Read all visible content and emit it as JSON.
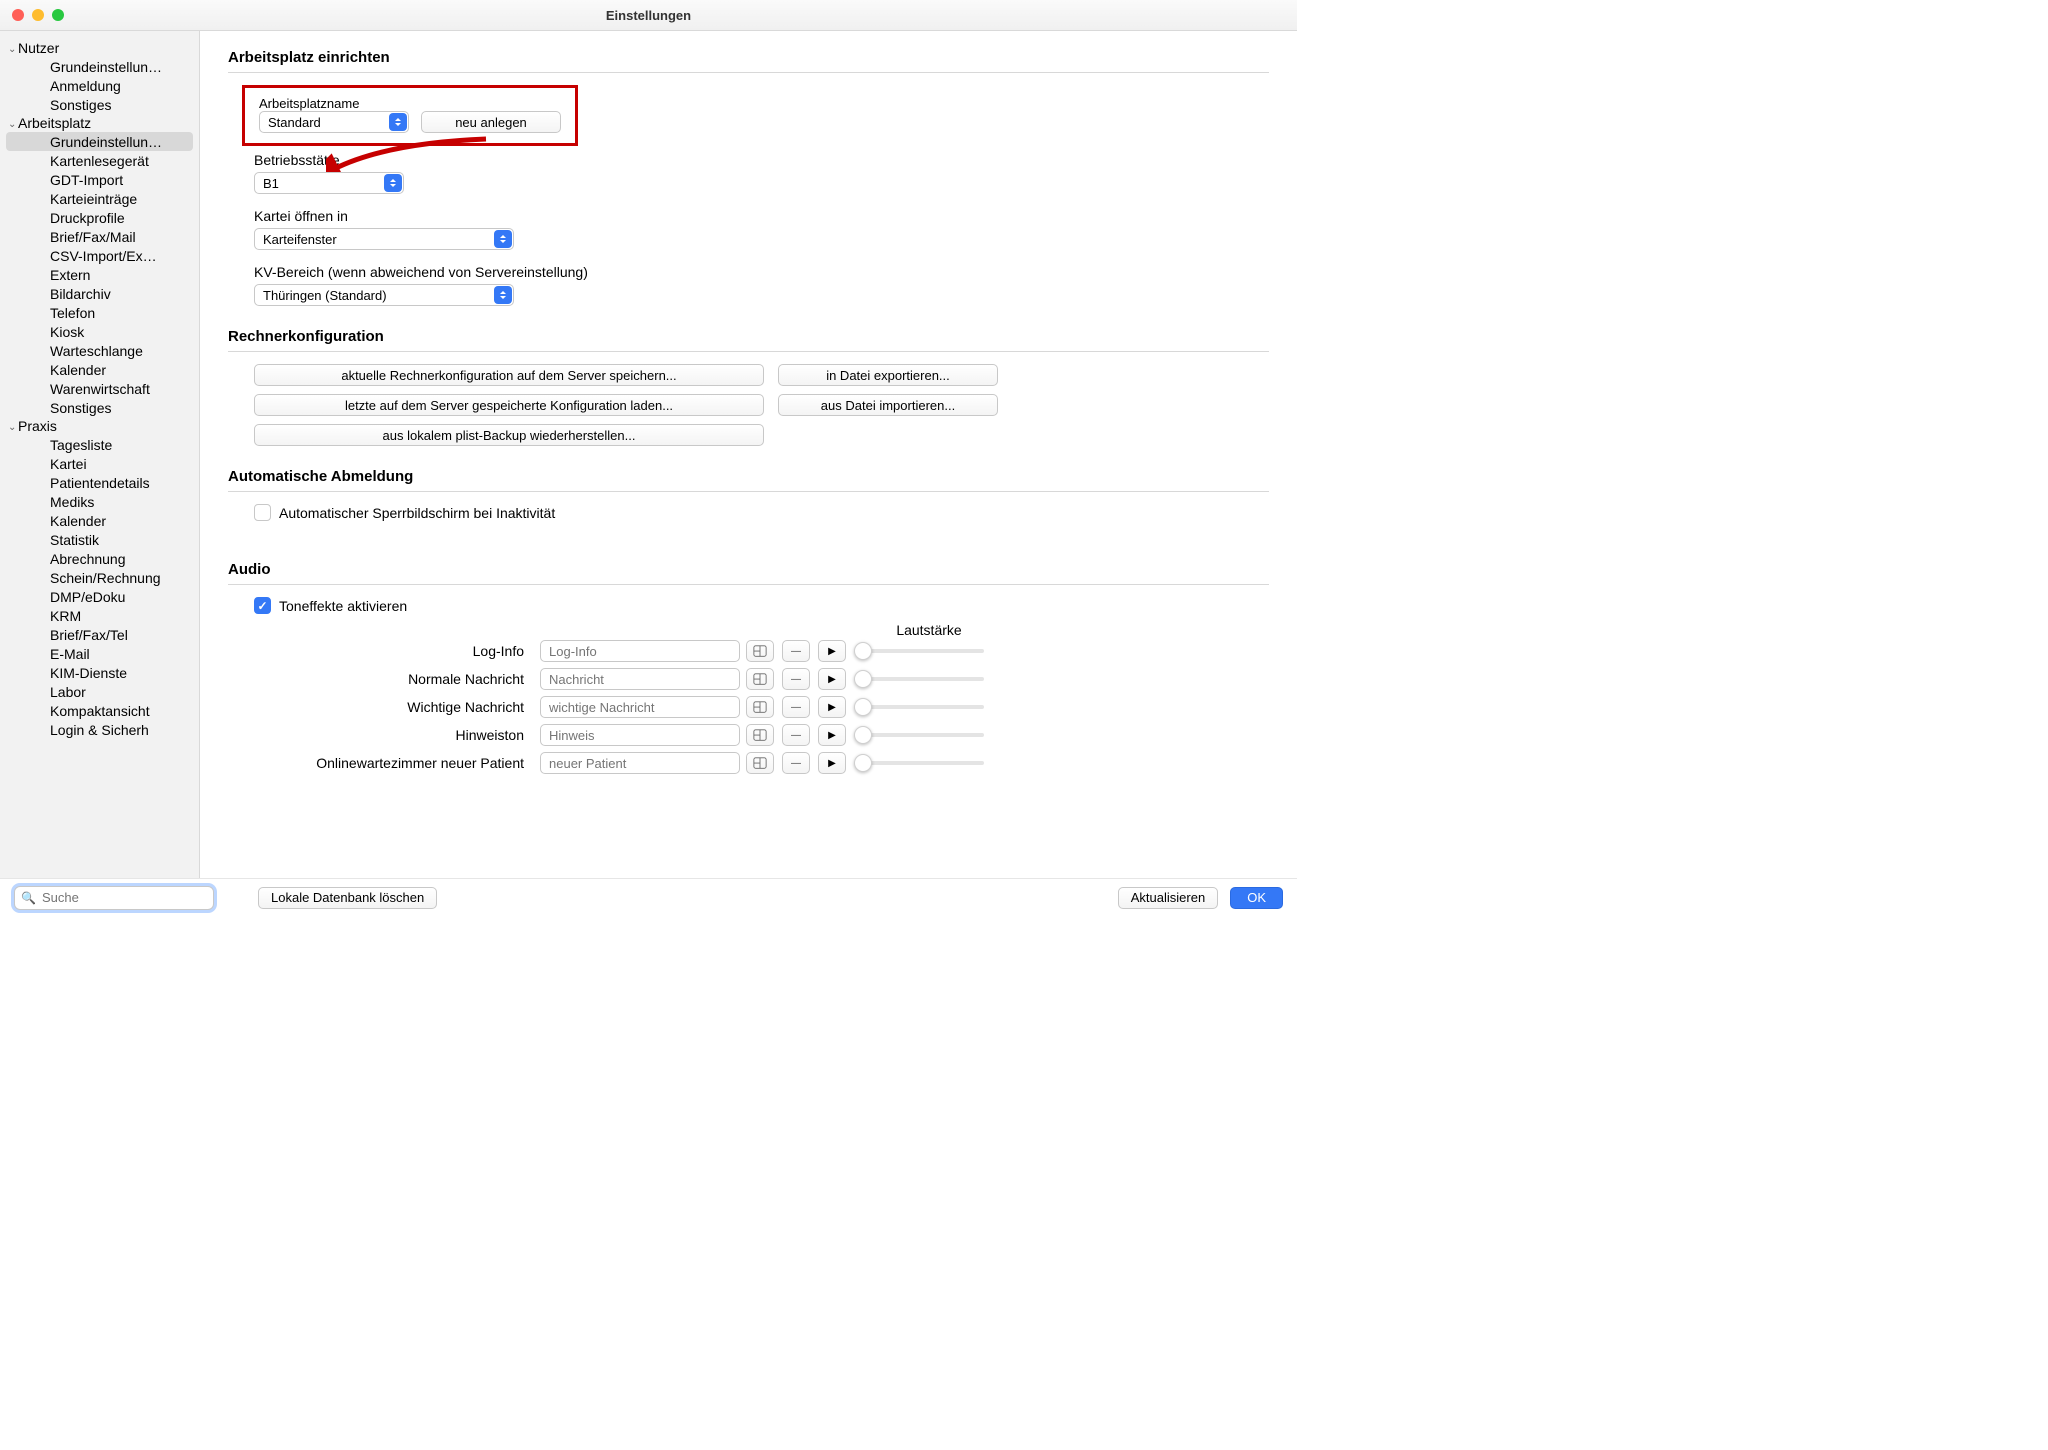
{
  "titlebar": {
    "title": "Einstellungen"
  },
  "sidebar": {
    "groups": [
      {
        "title": "Nutzer",
        "items": [
          "Grundeinstellun…",
          "Anmeldung",
          "Sonstiges"
        ]
      },
      {
        "title": "Arbeitsplatz",
        "items": [
          "Grundeinstellun…",
          "Kartenlesegerät",
          "GDT-Import",
          "Karteieinträge",
          "Druckprofile",
          "Brief/Fax/Mail",
          "CSV-Import/Ex…",
          "Extern",
          "Bildarchiv",
          "Telefon",
          "Kiosk",
          "Warteschlange",
          "Kalender",
          "Warenwirtschaft",
          "Sonstiges"
        ],
        "selected_index": 0
      },
      {
        "title": "Praxis",
        "items": [
          "Tagesliste",
          "Kartei",
          "Patientendetails",
          "Mediks",
          "Kalender",
          "Statistik",
          "Abrechnung",
          "Schein/Rechnung",
          "DMP/eDoku",
          "KRM",
          "Brief/Fax/Tel",
          "E-Mail",
          "KIM-Dienste",
          "Labor",
          "Kompaktansicht",
          "Login & Sicherh"
        ]
      }
    ],
    "search_placeholder": "Suche"
  },
  "sections": {
    "arbeitsplatz": {
      "heading": "Arbeitsplatz einrichten",
      "name_label": "Arbeitsplatzname",
      "name_value": "Standard",
      "neu_button": "neu anlegen",
      "betrieb_label": "Betriebsstätte",
      "betrieb_value": "B1",
      "kartei_label": "Kartei öffnen in",
      "kartei_value": "Karteifenster",
      "kv_label": "KV-Bereich (wenn abweichend von Servereinstellung)",
      "kv_value": "Thüringen (Standard)"
    },
    "rechner": {
      "heading": "Rechnerkonfiguration",
      "b1": "aktuelle Rechnerkonfiguration auf dem Server speichern...",
      "b2": "in Datei exportieren...",
      "b3": "letzte auf dem Server gespeicherte Konfiguration laden...",
      "b4": "aus Datei importieren...",
      "b5": "aus lokalem plist-Backup wiederherstellen..."
    },
    "abmeldung": {
      "heading": "Automatische Abmeldung",
      "check_label": "Automatischer Sperrbildschirm bei Inaktivität"
    },
    "audio": {
      "heading": "Audio",
      "activate_label": "Toneffekte aktivieren",
      "volume_head": "Lautstärke",
      "rows": [
        {
          "label": "Log-Info",
          "placeholder": "Log-Info"
        },
        {
          "label": "Normale Nachricht",
          "placeholder": "Nachricht"
        },
        {
          "label": "Wichtige Nachricht",
          "placeholder": "wichtige Nachricht"
        },
        {
          "label": "Hinweiston",
          "placeholder": "Hinweis"
        },
        {
          "label": "Onlinewartezimmer neuer Patient",
          "placeholder": "neuer Patient"
        }
      ]
    }
  },
  "footer": {
    "local_db": "Lokale Datenbank löschen",
    "update": "Aktualisieren",
    "ok": "OK"
  }
}
